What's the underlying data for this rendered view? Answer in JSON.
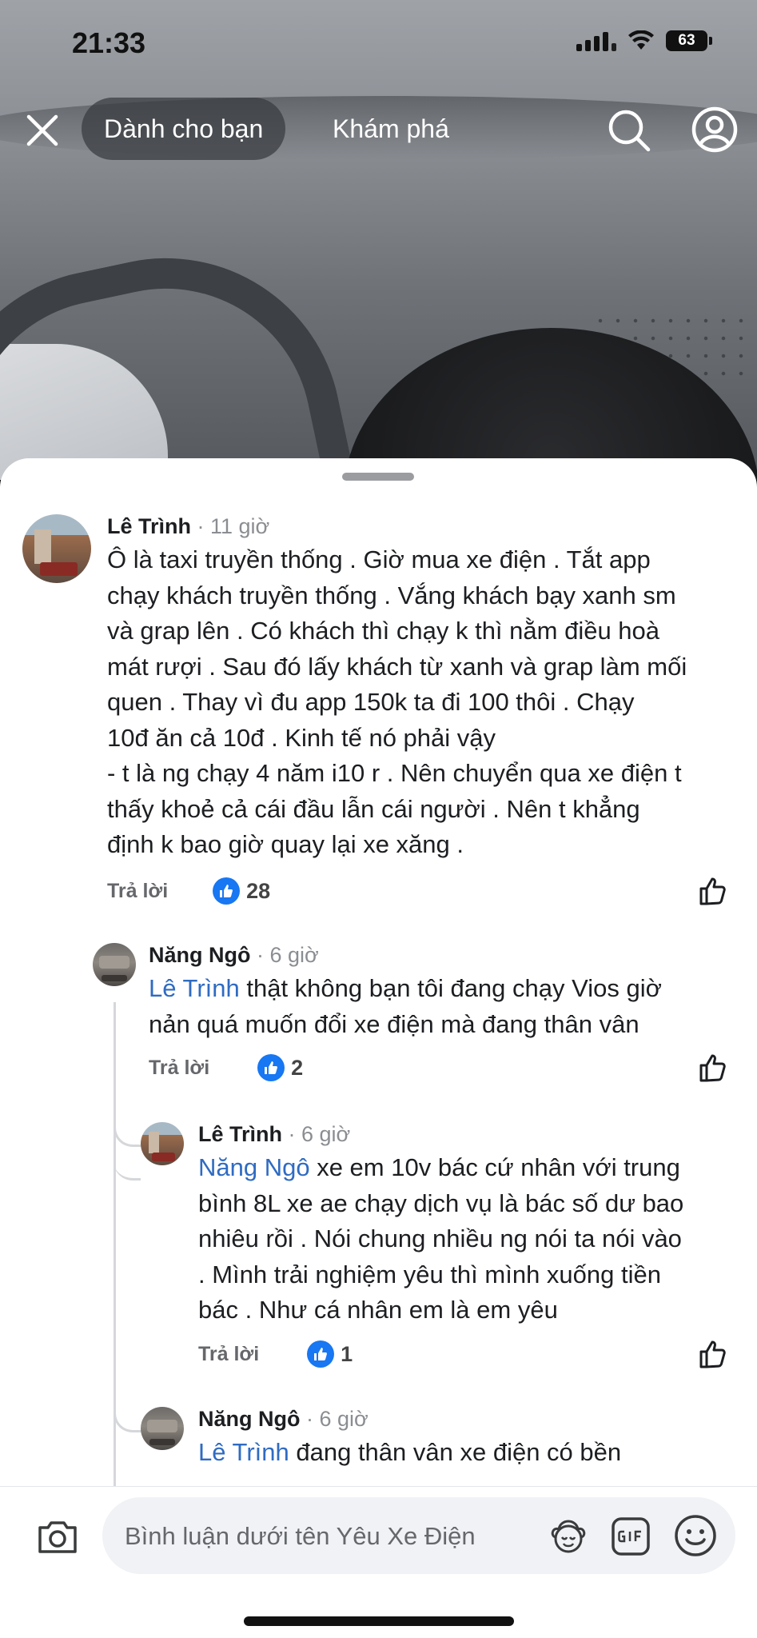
{
  "status_bar": {
    "time": "21:33",
    "battery": "63"
  },
  "nav": {
    "tab_active": "Dành cho bạn",
    "tab_other": "Khám phá"
  },
  "comments": [
    {
      "author": "Lê Trình",
      "sep": " · ",
      "time": "11 giờ",
      "lines": [
        "Ô là taxi truyền thống . Giờ mua xe điện . Tắt app",
        "chạy khách truyền thống . Vắng khách bạy xanh sm",
        "và grap lên . Có khách thì chạy k thì nằm điều hoà",
        "mát rượi .  Sau đó lấy khách từ xanh và grap làm mối",
        "quen . Thay vì đu app 150k ta đi 100 thôi .  Chạy",
        "10đ ăn cả 10đ . Kinh tế nó phải vậy",
        "- t là ng chạy 4 năm i10 r . Nên chuyển qua xe điện t",
        "thấy khoẻ cả cái đầu lẫn cái người . Nên t khẳng",
        "định k bao giờ quay lại xe xăng ."
      ],
      "reply_label": "Trả lời",
      "likes": "28"
    },
    {
      "author": "Năng Ngô",
      "sep": " · ",
      "time": "6 giờ",
      "mention": "Lê Trình",
      "line1": " thật không bạn tôi đang chạy Vios giờ",
      "lines": [
        "nản quá muốn đổi xe điện mà đang thân vân"
      ],
      "reply_label": "Trả lời",
      "likes": "2"
    },
    {
      "author": "Lê Trình",
      "sep": " · ",
      "time": "6 giờ",
      "mention": "Năng Ngô",
      "line1": " xe em 10v bác cứ nhân với trung",
      "lines": [
        "bình 8L xe ae chạy dịch vụ là bác số dư bao",
        "nhiêu rồi . Nói chung nhiều ng nói ta nói vào",
        ". Mình trải nghiệm yêu thì mình xuống tiền",
        "bác . Như cá nhân em là em yêu"
      ],
      "reply_label": "Trả lời",
      "likes": "1"
    },
    {
      "author": "Năng Ngô",
      "sep": " · ",
      "time": "6 giờ",
      "mention": "Lê Trình",
      "line1": " đang thân vân xe điện có bền"
    }
  ],
  "composer": {
    "placeholder": "Bình luận dưới tên Yêu Xe Điện"
  },
  "colors": {
    "like_blue": "#1877f2",
    "mention_blue": "#2f6bc2"
  }
}
